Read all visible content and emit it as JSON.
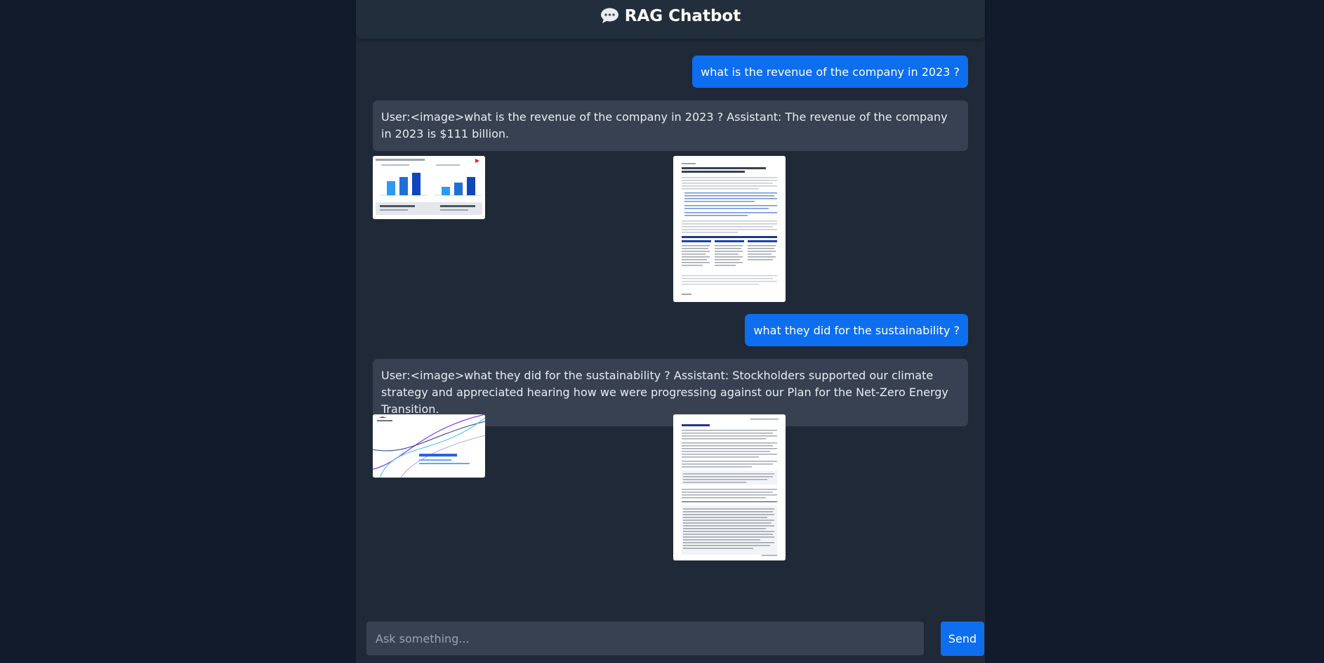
{
  "header": {
    "title": "RAG Chatbot",
    "icon": "speech-bubble-icon"
  },
  "messages": [
    {
      "role": "user",
      "text": "what is the revenue of the company in 2023 ?"
    },
    {
      "role": "assistant",
      "text": "User:<image>what is the revenue of the company in 2023 ? Assistant: The revenue of the company in 2023 is $111 billion.",
      "images": [
        {
          "kind": "chart-slide-thumbnail"
        },
        {
          "kind": "document-page-thumbnail"
        }
      ]
    },
    {
      "role": "user",
      "text": "what they did for the sustainability ?"
    },
    {
      "role": "assistant",
      "text": "User:<image>what they did for the sustainability ? Assistant: Stockholders supported our climate strategy and appreciated hearing how we were progressing against our Plan for the Net-Zero Energy Transition.",
      "images": [
        {
          "kind": "title-slide-thumbnail"
        },
        {
          "kind": "document-page-thumbnail"
        }
      ]
    }
  ],
  "composer": {
    "placeholder": "Ask something...",
    "send_label": "Send"
  },
  "colors": {
    "background": "#111b2b",
    "panel": "#1f2937",
    "user_bubble": "#0d6ef0",
    "assistant_bubble": "#374151",
    "send_button": "#0d6ef0"
  }
}
